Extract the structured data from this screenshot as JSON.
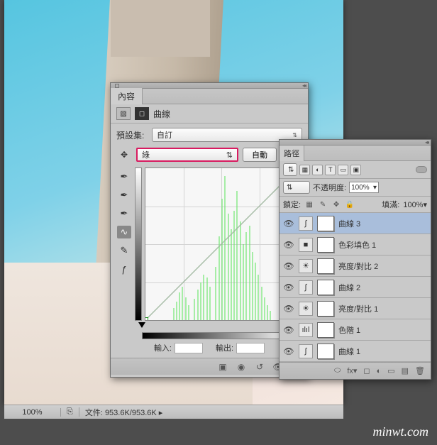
{
  "status": {
    "zoom": "100%",
    "doc_label": "文件:",
    "doc_size": "953.6K/953.6K"
  },
  "adj_panel": {
    "tab": "內容",
    "title": "曲線",
    "preset_label": "預設集:",
    "preset_value": "自訂",
    "channel_value": "綠",
    "auto_btn": "自動",
    "input_label": "輸入:",
    "output_label": "輸出:"
  },
  "layers_panel": {
    "tabs": {
      "paths": "路徑"
    },
    "filter_kind": "",
    "blend_mode": "",
    "opacity_label": "不透明度:",
    "opacity_value": "100%",
    "lock_label": "鎖定:",
    "fill_label": "填滿:",
    "fill_value": "100%",
    "layers": [
      {
        "name": "曲線 3",
        "selected": true,
        "adj": "curves"
      },
      {
        "name": "色彩填色 1",
        "adj": "fill"
      },
      {
        "name": "亮度/對比 2",
        "adj": "bc"
      },
      {
        "name": "曲線 2",
        "adj": "curves"
      },
      {
        "name": "亮度/對比 1",
        "adj": "bc"
      },
      {
        "name": "色階 1",
        "adj": "levels"
      },
      {
        "name": "曲線 1",
        "adj": "curves"
      }
    ]
  },
  "chart_data": {
    "type": "line",
    "title": "曲線",
    "xlabel": "輸入",
    "ylabel": "輸出",
    "xlim": [
      0,
      255
    ],
    "ylim": [
      0,
      255
    ],
    "series": [
      {
        "name": "綠",
        "x": [
          0,
          255
        ],
        "y": [
          0,
          255
        ]
      }
    ],
    "histogram_channel": "綠"
  },
  "watermark": "minwt.com"
}
